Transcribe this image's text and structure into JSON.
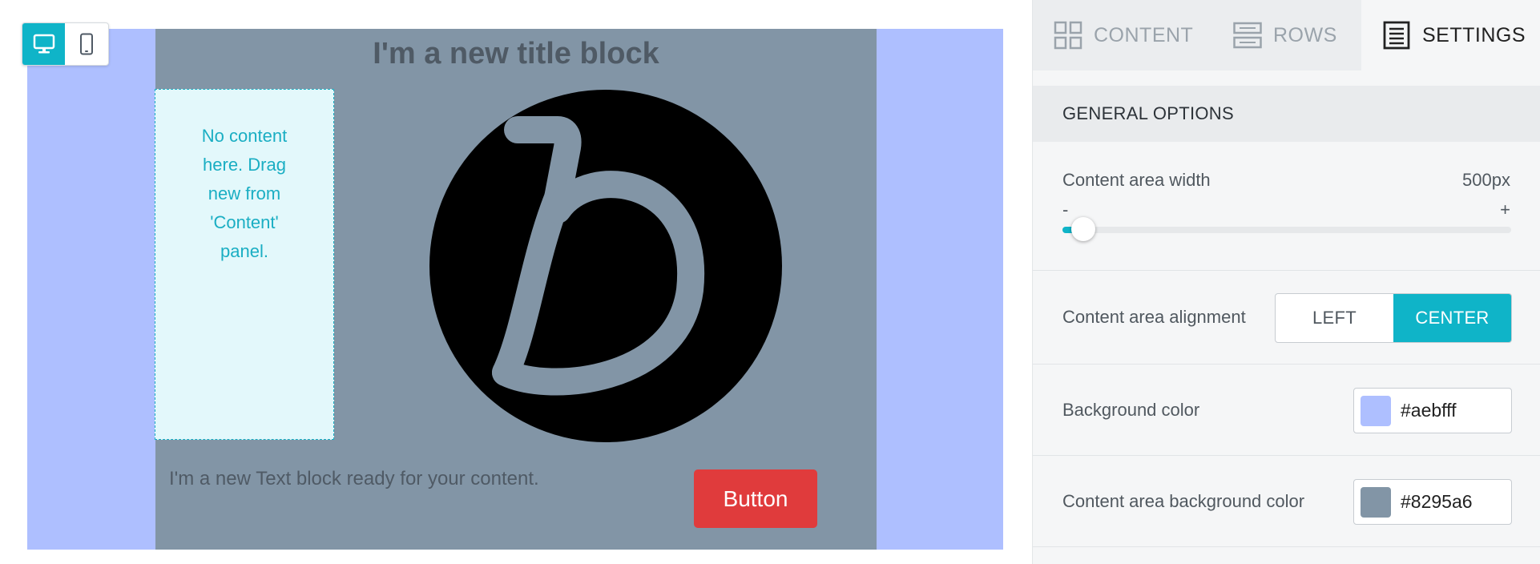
{
  "device_toggle": {
    "desktop_icon": "desktop-icon",
    "mobile_icon": "mobile-icon",
    "active": "desktop"
  },
  "email": {
    "background_color": "#aebfff",
    "content_background_color": "#8295a6",
    "title": "I'm a new title block",
    "empty_column_text": "No content here. Drag new from 'Content' panel.",
    "logo_icon": "brand-b-logo",
    "text_block": "I'm a new Text block ready for your content.",
    "button_label": "Button",
    "button_color": "#e03b3c"
  },
  "sidebar": {
    "tabs": [
      {
        "label": "CONTENT",
        "icon": "grid-icon"
      },
      {
        "label": "ROWS",
        "icon": "rows-icon"
      },
      {
        "label": "SETTINGS",
        "icon": "settings-doc-icon",
        "active": true
      }
    ],
    "section_title": "GENERAL OPTIONS",
    "content_width": {
      "label": "Content area width",
      "value": "500px",
      "minus": "-",
      "plus": "+",
      "slider_fraction": 0.047
    },
    "alignment": {
      "label": "Content area alignment",
      "options": [
        "LEFT",
        "CENTER"
      ],
      "selected": "CENTER"
    },
    "background_color": {
      "label": "Background color",
      "value": "#aebfff"
    },
    "content_background_color": {
      "label": "Content area background color",
      "value": "#8295a6"
    },
    "accent_color": "#0fb4c8"
  }
}
